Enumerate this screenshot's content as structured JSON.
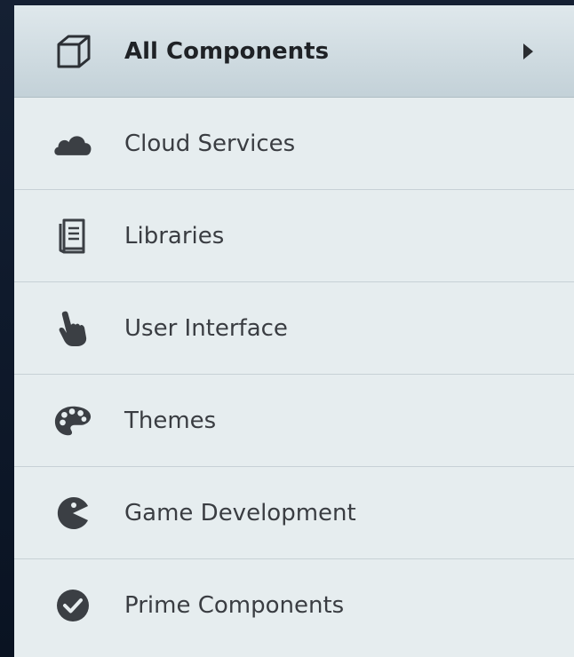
{
  "menu": {
    "items": [
      {
        "label": "All Components",
        "icon": "cube-icon",
        "active": true
      },
      {
        "label": "Cloud Services",
        "icon": "cloud-icon"
      },
      {
        "label": "Libraries",
        "icon": "book-icon"
      },
      {
        "label": "User Interface",
        "icon": "pointer-hand-icon"
      },
      {
        "label": "Themes",
        "icon": "palette-icon"
      },
      {
        "label": "Game Development",
        "icon": "pacman-icon"
      },
      {
        "label": "Prime Components",
        "icon": "check-circle-icon"
      }
    ]
  },
  "colors": {
    "background": "#0d1626",
    "panel": "#e6edef",
    "active_item": "#c3d1d8",
    "divider": "#c7d1d6",
    "text": "#3a3d42",
    "icon": "#3b3f44"
  }
}
